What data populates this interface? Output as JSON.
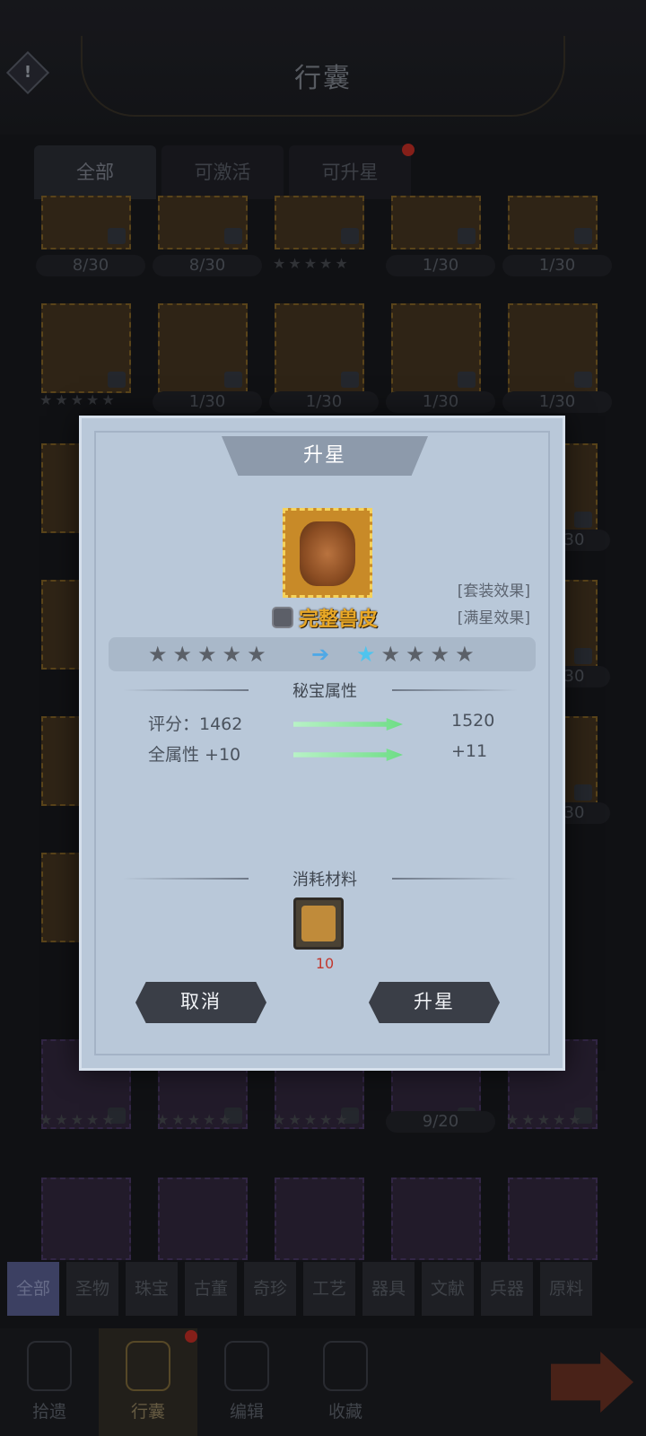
{
  "header": {
    "title": "行囊",
    "alert_symbol": "!"
  },
  "top_tabs": [
    {
      "label": "全部",
      "active": true
    },
    {
      "label": "可激活",
      "active": false
    },
    {
      "label": "可升星",
      "active": false
    }
  ],
  "grid_counters": [
    [
      "8/30",
      "8/30",
      "",
      "1/30",
      "1/30"
    ],
    [
      "",
      "1/30",
      "1/30",
      "1/30",
      "1/30"
    ]
  ],
  "side_counters": [
    "30",
    "30",
    "30"
  ],
  "lower_counter": "9/20",
  "categories": [
    {
      "label": "全部",
      "active": true
    },
    {
      "label": "圣物"
    },
    {
      "label": "珠宝"
    },
    {
      "label": "古董"
    },
    {
      "label": "奇珍"
    },
    {
      "label": "工艺"
    },
    {
      "label": "器具"
    },
    {
      "label": "文献"
    },
    {
      "label": "兵器"
    },
    {
      "label": "原料"
    }
  ],
  "bottom_nav": [
    {
      "label": "拾遗",
      "icon": "card-icon"
    },
    {
      "label": "行囊",
      "icon": "backpack-icon",
      "active": true
    },
    {
      "label": "编辑",
      "icon": "tools-icon"
    },
    {
      "label": "收藏",
      "icon": "scroll-icon"
    }
  ],
  "dialog": {
    "title": "升星",
    "item": {
      "name": "完整兽皮",
      "icon": "beast-hide-icon"
    },
    "links": {
      "set_effect": "套装效果",
      "max_star_effect": "满星效果"
    },
    "stars": {
      "current": 0,
      "next": 1,
      "max": 5
    },
    "attributes_title": "秘宝属性",
    "stats": [
      {
        "label": "评分：1462",
        "new_value": "1520"
      },
      {
        "label": "全属性 +10",
        "new_value": "+11"
      }
    ],
    "materials_title": "消耗材料",
    "material": {
      "icon": "puzzle-piece-icon",
      "quantity": "10"
    },
    "buttons": {
      "cancel": "取消",
      "confirm": "升星"
    }
  },
  "colors": {
    "item_name": "#e9a826",
    "material_qty": "#c2382e",
    "star_lit": "#4fc4ee",
    "stat_arrow": "#6edd86"
  }
}
